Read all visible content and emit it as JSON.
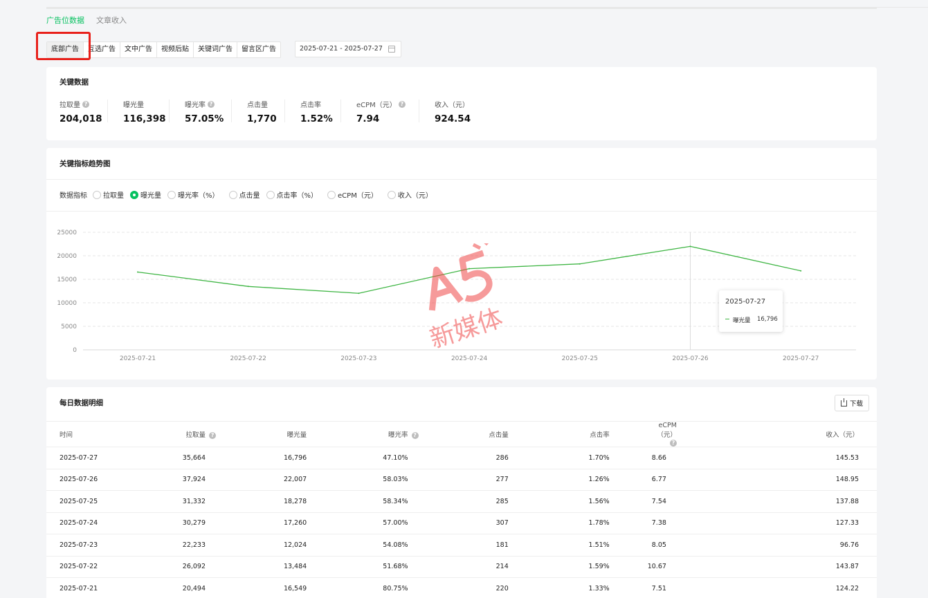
{
  "tabs": [
    {
      "label": "广告位数据",
      "active": true
    },
    {
      "label": "文章收入",
      "active": false
    }
  ],
  "ad_types": [
    {
      "label": "底部广告",
      "active": true
    },
    {
      "label": "互选广告",
      "active": false
    },
    {
      "label": "文中广告",
      "active": false
    },
    {
      "label": "视频后贴",
      "active": false
    },
    {
      "label": "关键词广告",
      "active": false
    },
    {
      "label": "留言区广告",
      "active": false
    }
  ],
  "date_range": "2025-07-21 - 2025-07-27",
  "key_data": {
    "title": "关键数据",
    "metrics": [
      {
        "label": "拉取量",
        "value": "204,018",
        "help": true
      },
      {
        "label": "曝光量",
        "value": "116,398",
        "help": false
      },
      {
        "label": "曝光率",
        "value": "57.05%",
        "help": true
      },
      {
        "label": "点击量",
        "value": "1,770",
        "help": false
      },
      {
        "label": "点击率",
        "value": "1.52%",
        "help": false
      },
      {
        "label": "eCPM（元）",
        "value": "7.94",
        "help": true
      },
      {
        "label": "收入（元）",
        "value": "924.54",
        "help": false
      }
    ]
  },
  "trend": {
    "title": "关键指标趋势图",
    "indicator_label": "数据指标",
    "options": [
      {
        "label": "拉取量",
        "selected": false
      },
      {
        "label": "曝光量",
        "selected": true
      },
      {
        "label": "曝光率（%）",
        "selected": false
      },
      {
        "label": "点击量",
        "selected": false
      },
      {
        "label": "点击率（%）",
        "selected": false
      },
      {
        "label": "eCPM（元）",
        "selected": false
      },
      {
        "label": "收入（元）",
        "selected": false
      }
    ],
    "tooltip": {
      "date": "2025-07-27",
      "series": "曝光量",
      "value": "16,796"
    }
  },
  "chart_data": {
    "type": "line",
    "x": [
      "2025-07-21",
      "2025-07-22",
      "2025-07-23",
      "2025-07-24",
      "2025-07-25",
      "2025-07-26",
      "2025-07-27"
    ],
    "series": [
      {
        "name": "曝光量",
        "values": [
          16549,
          13484,
          12024,
          17260,
          18278,
          22007,
          16796
        ],
        "color": "#3eb543"
      }
    ],
    "yticks": [
      0,
      5000,
      10000,
      15000,
      20000,
      25000
    ],
    "ylim": [
      0,
      25000
    ],
    "grid": true,
    "hover_index": 5
  },
  "daily": {
    "title": "每日数据明细",
    "download_label": "下载",
    "columns": [
      {
        "label": "时间",
        "help": false
      },
      {
        "label": "拉取量",
        "help": true
      },
      {
        "label": "曝光量",
        "help": false
      },
      {
        "label": "曝光率",
        "help": true
      },
      {
        "label": "点击量",
        "help": false
      },
      {
        "label": "点击率",
        "help": false
      },
      {
        "label": "eCPM（元）",
        "help": true
      },
      {
        "label": "收入（元）",
        "help": false
      }
    ],
    "rows": [
      [
        "2025-07-27",
        "35,664",
        "16,796",
        "47.10%",
        "286",
        "1.70%",
        "8.66",
        "145.53"
      ],
      [
        "2025-07-26",
        "37,924",
        "22,007",
        "58.03%",
        "277",
        "1.26%",
        "6.77",
        "148.95"
      ],
      [
        "2025-07-25",
        "31,332",
        "18,278",
        "58.34%",
        "285",
        "1.56%",
        "7.54",
        "137.88"
      ],
      [
        "2025-07-24",
        "30,279",
        "17,260",
        "57.00%",
        "307",
        "1.78%",
        "7.38",
        "127.33"
      ],
      [
        "2025-07-23",
        "22,233",
        "12,024",
        "54.08%",
        "181",
        "1.51%",
        "8.05",
        "96.76"
      ],
      [
        "2025-07-22",
        "26,092",
        "13,484",
        "51.68%",
        "214",
        "1.59%",
        "10.67",
        "143.87"
      ],
      [
        "2025-07-21",
        "20,494",
        "16,549",
        "80.75%",
        "220",
        "1.33%",
        "7.51",
        "124.22"
      ]
    ]
  },
  "watermark": {
    "logo": "A5",
    "text": "新媒体",
    "color": "#f04848"
  }
}
